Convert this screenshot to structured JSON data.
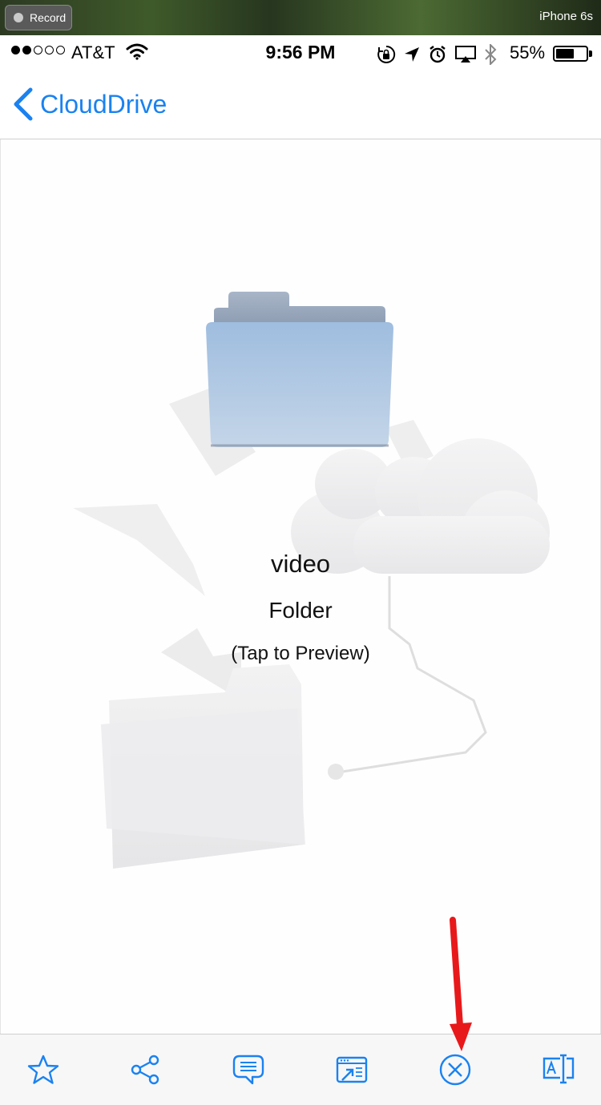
{
  "recorder": {
    "record_label": "Record",
    "device": "iPhone 6s"
  },
  "status_bar": {
    "carrier": "AT&T",
    "time": "9:56 PM",
    "battery_percent": "55%",
    "signal_bars_filled": 2,
    "signal_bars_total": 5
  },
  "nav": {
    "back_label": "CloudDrive"
  },
  "preview": {
    "name": "video",
    "type": "Folder",
    "hint": "(Tap to Preview)"
  },
  "toolbar": {
    "items": [
      {
        "icon": "star-icon"
      },
      {
        "icon": "share-icon"
      },
      {
        "icon": "comment-icon"
      },
      {
        "icon": "open-in-icon"
      },
      {
        "icon": "close-circle-icon"
      },
      {
        "icon": "rename-icon"
      }
    ]
  },
  "colors": {
    "accent": "#1a82f0",
    "annotation": "#e8191b"
  }
}
